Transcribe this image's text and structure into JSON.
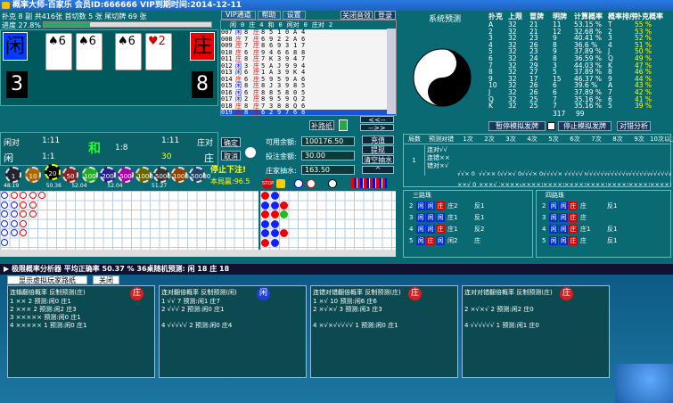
{
  "window": {
    "title": "概率大师-百家乐 会员ID:666666 VIP到期时间:2014-12-11"
  },
  "menu": {
    "items": [
      "VIP通道",
      "帮助",
      "设置"
    ],
    "close_sound": "关闭音效",
    "login": "登录"
  },
  "status": {
    "line1": "扑克 8  副 共416张  首切数  5  张  尾切牌 69 张",
    "progress_label": "进度 27.8%",
    "progress": 0.278
  },
  "player": {
    "label": "闲",
    "score": "3",
    "cards": [
      "♠6",
      "♠6"
    ]
  },
  "banker": {
    "label": "庄",
    "score": "8",
    "cards": [
      "♠6",
      "♥2"
    ]
  },
  "hist": {
    "header": [
      "闲",
      "0",
      "庄",
      "4",
      "和",
      "0",
      "闲对",
      "0",
      "庄对",
      "2"
    ],
    "rows": [
      [
        "007",
        "闲",
        "8",
        "庄",
        "8",
        "5",
        "1",
        "0",
        "A",
        "4"
      ],
      [
        "008",
        "庄",
        "7",
        "庄",
        "6",
        "9",
        "2",
        "2",
        "A",
        "6"
      ],
      [
        "009",
        "庄",
        "7",
        "庄",
        "8",
        "6",
        "9",
        "3",
        "1",
        "7"
      ],
      [
        "010",
        "庄",
        "6",
        "庄",
        "9",
        "4",
        "6",
        "6",
        "8",
        "8"
      ],
      [
        "011",
        "庄",
        "8",
        "庄",
        "7",
        "K",
        "3",
        "9",
        "4",
        "7"
      ],
      [
        "012",
        "闲",
        "3",
        "庄",
        "5",
        "A",
        "J",
        "9",
        "9",
        "4"
      ],
      [
        "013",
        "闲",
        "6",
        "庄",
        "1",
        "A",
        "3",
        "9",
        "K",
        "4"
      ],
      [
        "014",
        "庄",
        "6",
        "庄",
        "5",
        "9",
        "5",
        "9",
        "A",
        "6"
      ],
      [
        "015",
        "闲",
        "8",
        "庄",
        "8",
        "J",
        "3",
        "9",
        "8",
        "5"
      ],
      [
        "016",
        "闲",
        "6",
        "庄",
        "8",
        "8",
        "5",
        "8",
        "0",
        "5"
      ],
      [
        "017",
        "闲",
        "2",
        "庄",
        "8",
        "9",
        "5",
        "9",
        "Q",
        "2"
      ],
      [
        "018",
        "庄",
        "8",
        "庄",
        "7",
        "3",
        "8",
        "8",
        "Q",
        "6"
      ],
      [
        "019",
        "庄",
        "8",
        "庄",
        "6",
        "2",
        "9",
        "7",
        "6",
        "8"
      ]
    ],
    "note": "庄对"
  },
  "system_predict": "系统预测",
  "stats": {
    "headers": [
      "扑克",
      "上限",
      "冒牌",
      "明牌",
      "计算概率",
      "概率排序",
      "扑克概率"
    ],
    "rows": [
      [
        "A",
        "32",
        "21",
        "11",
        "53.15 %",
        "T",
        "55 %"
      ],
      [
        "2",
        "32",
        "21",
        "12",
        "32.68 %",
        "2",
        "53 %"
      ],
      [
        "3",
        "32",
        "23",
        "9",
        "40.41 %",
        "3",
        "52 %"
      ],
      [
        "4",
        "32",
        "26",
        "8",
        "36.6 %",
        "4",
        "51 %"
      ],
      [
        "5",
        "32",
        "23",
        "9",
        "37.89 %",
        "J",
        "50 %"
      ],
      [
        "6",
        "32",
        "24",
        "8",
        "36.59 %",
        "Q",
        "49 %"
      ],
      [
        "7",
        "32",
        "29",
        "3",
        "44.03 %",
        "K",
        "47 %"
      ],
      [
        "8",
        "32",
        "27",
        "5",
        "37.89 %",
        "8",
        "46 %"
      ],
      [
        "9",
        "32",
        "17",
        "15",
        "46.37 %",
        "9",
        "44 %"
      ],
      [
        "10",
        "32",
        "26",
        "6",
        "39.6 %",
        "A",
        "43 %"
      ],
      [
        "J",
        "32",
        "26",
        "6",
        "37.89 %",
        "7",
        "42 %"
      ],
      [
        "Q",
        "32",
        "25",
        "7",
        "35.16 %",
        "6",
        "41 %"
      ],
      [
        "K",
        "32",
        "25",
        "7",
        "35.16 %",
        "5",
        "39 %"
      ]
    ],
    "totals": [
      "317",
      "99"
    ]
  },
  "sim": {
    "pause": "暂停模拟发牌",
    "stop": "停止模拟发牌",
    "analysis": "对错分析"
  },
  "bet": {
    "pair_label": "闲对",
    "pair_odds": "1:11",
    "tie_label": "和",
    "tie_odds": "1:8",
    "bpair_odds": "1:11",
    "bpair_label": "庄对",
    "player_label": "闲",
    "player_odds": "1:1",
    "banker_label": "庄",
    "banker_value": "30",
    "banker_odds": "1:1",
    "confirm": "确定",
    "cancel": "取消",
    "stop_bet": "停止下注!",
    "this_round": "本局赢:96.5",
    "available_label": "可用余额:",
    "available": "100176.50",
    "bet_label": "投注金额:",
    "bet": "30.00",
    "commission_label": "庄家抽水:",
    "commission": "163.50",
    "deposit": "充值",
    "withdraw": "提现",
    "clear": "清空抽水",
    "add_road": "补路纸",
    "nav_prev": "<<--",
    "nav_next": "-->>"
  },
  "chips": {
    "values": [
      "1",
      "10",
      "20",
      "50",
      "100",
      "200",
      "500",
      "1000",
      "5000",
      "10000",
      "50000"
    ],
    "totals": [
      "48.19",
      "50.36",
      "52.04",
      "52.04",
      "51.27"
    ]
  },
  "predict_table": {
    "headers": [
      "局数",
      "预测对错",
      "1次",
      "2次",
      "3次",
      "4次",
      "5次",
      "6次",
      "7次",
      "8次",
      "9次",
      "10次以上"
    ],
    "sub": [
      "连对√√",
      "连错××",
      "错对×√"
    ],
    "rows": [
      [
        "√√× 0",
        "√√×× 0",
        "√√×√ 0",
        "√√√× 0",
        "√√√√× 0",
        "√√√√√ 0",
        "√√√√√√ 1",
        "√√√√√√√ 1",
        "√√√√√√√√ 0",
        "√√√√√√√√√ 0"
      ],
      [
        "××√ 0",
        "×××√ 1",
        "××××√ 0",
        "×××××√ 0",
        "××××××√ 0",
        "×××××××√ 0",
        "××××××××√ 0",
        "×××××××××√ 0",
        "××××××××××√ 0",
        "×××××××××××√ 0"
      ]
    ]
  },
  "roads": {
    "three": "三路珠",
    "four": "四路珠",
    "three_rows": [
      [
        "闲",
        "闲",
        "庄",
        "庄2"
      ],
      [
        "闲",
        "闲",
        "闲",
        "庄1"
      ],
      [
        "闲",
        "闲",
        "庄",
        "庄1"
      ],
      [
        "闲",
        "庄",
        "闲",
        "闲2"
      ]
    ],
    "three_right": [
      "反1",
      "反1",
      "反2",
      "庄"
    ],
    "four_rows": [
      [
        "闲",
        "闲",
        "庄",
        "庄"
      ],
      [
        "闲",
        "闲",
        "庄",
        "庄"
      ],
      [
        "闲",
        "闲",
        "庄",
        "庄1"
      ],
      [
        "闲",
        "闲",
        "庄",
        "庄"
      ]
    ],
    "four_right": [
      "反1",
      "",
      "反1",
      "反1"
    ]
  },
  "analyzer": {
    "title": "▶ 极限概率分析器  平均正确率 50.37 %   36桌随机预测: 闲 18 庄 18",
    "show_path": "显示虚拟玩家路纸",
    "close": "关闭",
    "panels": [
      {
        "title": "连输翻倍概率 反制预测(庄)",
        "badge": "庄",
        "badge_color": "#d42020",
        "lines": [
          "1 ×× 2 预测:闲0 庄1",
          "2 ××× 2 预测:闲2 庄3",
          "3 ××××× 预测:闲0 庄1",
          "4 ××××× 1 预测:闲0 庄1"
        ]
      },
      {
        "title": "连对翻倍概率 反制预测(闲)",
        "badge": "闲",
        "badge_color": "#2040d0",
        "lines": [
          "1 √√ 7 预测:闲1 庄7",
          "2 √√√ 2 预测:闲0 庄1",
          "",
          "4 √√√√√ 2 预测:闲0 庄4"
        ]
      },
      {
        "title": "连错对错翻倍概率 反制预测(庄)",
        "badge": "庄",
        "badge_color": "#d42020",
        "lines": [
          "1 ×√ 10 预测:闲6 庄6",
          "2 ×√×√ 3 预测:闲3 庄3",
          "",
          "4 ×√×√√√√√ 1 预测:闲0 庄1"
        ]
      },
      {
        "title": "连对对错翻倍概率 反制预测(庄)",
        "badge": "庄",
        "badge_color": "#d42020",
        "lines": [
          "",
          "2 ×√×√ 2 预测:闲2 庄0",
          "",
          "4 √√√√√√ 1 预测:闲1 庄0"
        ]
      }
    ]
  }
}
